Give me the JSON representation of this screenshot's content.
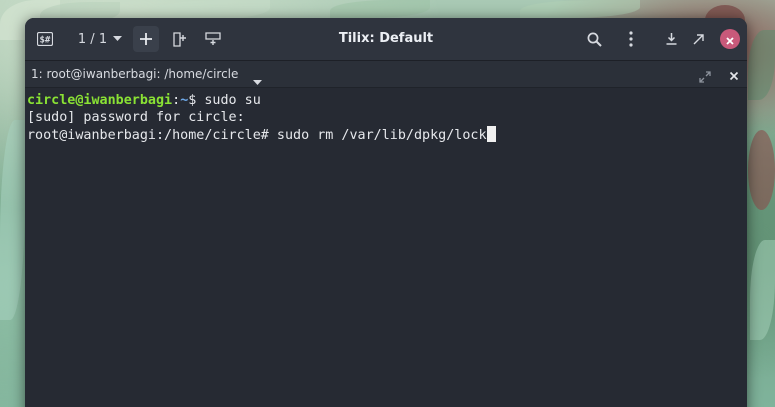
{
  "headerbar": {
    "session_count": "1 / 1",
    "title": "Tilix: Default"
  },
  "session": {
    "title": "1: root@iwanberbagi: /home/circle"
  },
  "terminal": {
    "line1_user_host": "circle@iwanberbagi",
    "line1_colon": ":",
    "line1_path": "~",
    "line1_rest": "$ sudo su",
    "line2": "[sudo] password for circle:",
    "line3": "root@iwanberbagi:/home/circle# sudo rm /var/lib/dpkg/lock"
  },
  "colors": {
    "accent_close": "#c8597a",
    "prompt_user": "#8ae234",
    "prompt_path": "#6ea8e8",
    "terminal_bg": "#262a33"
  },
  "icons": [
    "terminal-menu-icon",
    "dropdown-arrow-icon",
    "plus-icon",
    "split-horizontal-icon",
    "split-vertical-icon",
    "search-icon",
    "kebab-menu-icon",
    "download-icon",
    "close-icon",
    "maximize-icon"
  ]
}
